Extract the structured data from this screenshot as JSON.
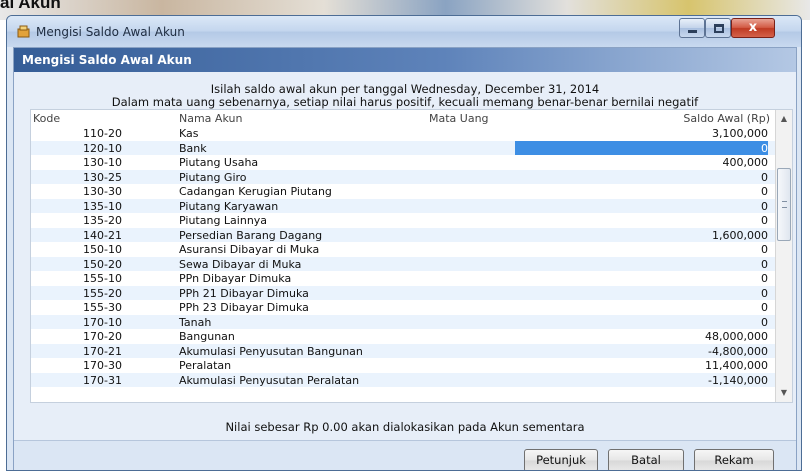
{
  "page": {
    "title": "al Akun"
  },
  "window": {
    "title": "Mengisi Saldo Awal Akun",
    "controls": {
      "minimize_icon": "minimize-icon",
      "maximize_icon": "maximize-icon",
      "close_icon": "close-icon",
      "close_glyph": "x"
    }
  },
  "panel": {
    "header": "Mengisi Saldo Awal Akun",
    "intro_line1": "Isilah saldo awal akun per tanggal Wednesday, December 31, 2014",
    "intro_line2": "Dalam mata uang sebenarnya, setiap nilai harus positif, kecuali memang benar-benar bernilai negatif"
  },
  "table": {
    "columns": {
      "kode": "Kode",
      "nama": "Nama Akun",
      "mata_uang": "Mata Uang",
      "saldo": "Saldo Awal (Rp)"
    },
    "rows": [
      {
        "kode": "110-20",
        "nama": "Kas",
        "saldo": "3,100,000"
      },
      {
        "kode": "120-10",
        "nama": "Bank",
        "saldo": "0"
      },
      {
        "kode": "130-10",
        "nama": "Piutang Usaha",
        "saldo": "400,000"
      },
      {
        "kode": "130-25",
        "nama": "Piutang Giro",
        "saldo": "0"
      },
      {
        "kode": "130-30",
        "nama": "Cadangan Kerugian Piutang",
        "saldo": "0"
      },
      {
        "kode": "135-10",
        "nama": "Piutang Karyawan",
        "saldo": "0"
      },
      {
        "kode": "135-20",
        "nama": "Piutang Lainnya",
        "saldo": "0"
      },
      {
        "kode": "140-21",
        "nama": "Persedian Barang Dagang",
        "saldo": "1,600,000"
      },
      {
        "kode": "150-10",
        "nama": "Asuransi Dibayar di Muka",
        "saldo": "0"
      },
      {
        "kode": "150-20",
        "nama": "Sewa Dibayar di Muka",
        "saldo": "0"
      },
      {
        "kode": "155-10",
        "nama": "PPn Dibayar Dimuka",
        "saldo": "0"
      },
      {
        "kode": "155-20",
        "nama": "PPh 21 Dibayar Dimuka",
        "saldo": "0"
      },
      {
        "kode": "155-30",
        "nama": "PPh 23 Dibayar Dimuka",
        "saldo": "0"
      },
      {
        "kode": "170-10",
        "nama": "Tanah",
        "saldo": "0"
      },
      {
        "kode": "170-20",
        "nama": "Bangunan",
        "saldo": "48,000,000"
      },
      {
        "kode": "170-21",
        "nama": "Akumulasi Penyusutan Bangunan",
        "saldo": "-4,800,000"
      },
      {
        "kode": "170-30",
        "nama": "Peralatan",
        "saldo": "11,400,000"
      },
      {
        "kode": "170-31",
        "nama": "Akumulasi Penyusutan Peralatan",
        "saldo": "-1,140,000"
      }
    ],
    "selected_row": 1,
    "scrollbar": {
      "up_glyph": "▲",
      "down_glyph": "▼"
    }
  },
  "footnote": "Nilai sebesar Rp 0.00 akan dialokasikan pada Akun sementara",
  "buttons": {
    "petunjuk": "Petunjuk",
    "batal": "Batal",
    "rekam": "Rekam"
  },
  "colors": {
    "header_band": "#355d97",
    "selection": "#3d8ee4",
    "row_alt": "#eaf3fd"
  }
}
